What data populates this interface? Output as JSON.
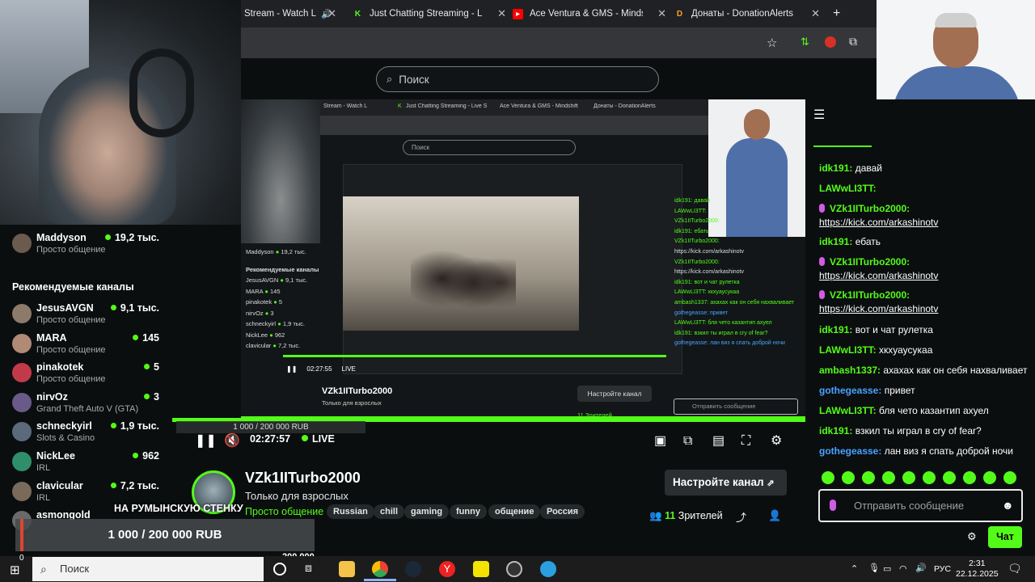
{
  "browser": {
    "tabs": [
      {
        "label": "Stream - Watch L",
        "icon": "speaker-icon"
      },
      {
        "label": "Just Chatting Streaming - Live S",
        "icon": "kick-logo-icon"
      },
      {
        "label": "Ace Ventura & GMS - Mindshift",
        "icon": "youtube-icon"
      },
      {
        "label": "Донаты - DonationAlerts",
        "icon": "donationalerts-icon"
      }
    ],
    "search_placeholder": "Поиск"
  },
  "nested": {
    "search": "Поиск",
    "left_title": "Рекомендуемые каналы",
    "top_channel": "Maddyson",
    "top_viewers": "19,2 тыс.",
    "channels": [
      "JesusAVGN",
      "MARA",
      "pinakotek",
      "nirvOz",
      "schneckyirl",
      "NickLee",
      "clavicular"
    ],
    "viewers": [
      "9,1 тыс.",
      "145",
      "5",
      "3",
      "1,9 тыс.",
      "962",
      "7,2 тыс."
    ],
    "channel_name": "VZk1IITurbo2000",
    "subtitle": "Только для взрослых",
    "setup_button": "Настройте канал",
    "time": "02:27:55",
    "live": "LIVE",
    "viewers_label": "11 Зрителей",
    "send_placeholder": "Отправить сообщение",
    "chat_lines": [
      "idk191: давай",
      "LAWwLI3TT:",
      "VZk1IITurbo2000:",
      "idk191: ебать",
      "VZk1IITurbo2000:",
      "https://kick.com/arkashinotv",
      "VZk1IITurbo2000:",
      "https://kick.com/arkashinotv",
      "idk191: вот и чат рулетка",
      "LAWwLI3TT: хкхуаусукаа",
      "ambash1337: ахахах как он себя нахваливает",
      "gothegeasse: привет",
      "LAWwLI3TT: бля чето казантип ахуел",
      "idk191: взкил ты играл в cry of fear?",
      "gothegeasse: лан виз я спать доброй ночи"
    ]
  },
  "sidebar": {
    "top": {
      "name": "Maddyson",
      "category": "Просто общение",
      "viewers": "19,2 тыс."
    },
    "section_title": "Рекомендуемые каналы",
    "channels": [
      {
        "name": "JesusAVGN",
        "category": "Просто общение",
        "viewers": "9,1 тыс."
      },
      {
        "name": "MARA",
        "category": "Просто общение",
        "viewers": "145"
      },
      {
        "name": "pinakotek",
        "category": "Просто общение",
        "viewers": "5"
      },
      {
        "name": "nirvOz",
        "category": "Grand Theft Auto V (GTA)",
        "viewers": "3"
      },
      {
        "name": "schneckyirl",
        "category": "Slots & Casino",
        "viewers": "1,9 тыс."
      },
      {
        "name": "NickLee",
        "category": "IRL",
        "viewers": "962"
      },
      {
        "name": "clavicular",
        "category": "IRL",
        "viewers": "7,2 тыс."
      },
      {
        "name": "asmongold",
        "category": "",
        "viewers": ""
      }
    ]
  },
  "player": {
    "time": "02:27:57",
    "live": "LIVE",
    "donation_small": "1 000 / 200 000 RUB",
    "progress": 1.0
  },
  "channel": {
    "name": "VZk1IITurbo2000",
    "title": "Только для взрослых",
    "category": "Просто общение",
    "tags": [
      "Russian",
      "chill",
      "gaming",
      "funny",
      "общение",
      "Россия"
    ],
    "setup_button": "Настройте канал",
    "viewers_count": "11",
    "viewers_label": "Зрителей"
  },
  "chat": {
    "lines": [
      {
        "user": "idk191",
        "text": "давай"
      },
      {
        "user": "LAWwLI3TT",
        "text": ""
      },
      {
        "user": "VZk1IITurbo2000",
        "text": ""
      },
      {
        "user": "",
        "text": "https://kick.com/arkashinotv"
      },
      {
        "user": "idk191",
        "text": "ебать"
      },
      {
        "user": "VZk1IITurbo2000",
        "text": ""
      },
      {
        "user": "",
        "text": "https://kick.com/arkashinotv"
      },
      {
        "user": "VZk1IITurbo2000",
        "text": ""
      },
      {
        "user": "",
        "text": "https://kick.com/arkashinotv"
      },
      {
        "user": "idk191",
        "text": "вот и чат рулетка"
      },
      {
        "user": "LAWwLI3TT",
        "text": "хкхуаусукаа"
      },
      {
        "user": "ambash1337",
        "text": "ахахах как он себя нахваливает"
      },
      {
        "user": "gothegeasse",
        "text": "привет"
      },
      {
        "user": "LAWwLI3TT",
        "text": "бля чето казантип ахуел"
      },
      {
        "user": "idk191",
        "text": "взкил ты играл в cry of fear?"
      },
      {
        "user": "gothegeasse",
        "text": "лан виз я спать доброй ночи"
      }
    ],
    "send_placeholder": "Отправить сообщение",
    "chat_button": "Чат"
  },
  "donation": {
    "title": "НА РУМЫНСКУЮ СТЕНКУ",
    "bar": "1 000 / 200 000 RUB",
    "total": "200 000"
  },
  "taskbar": {
    "search": "Поиск",
    "language": "РУС",
    "time": "2:31",
    "date": "22.12.2025",
    "badge": "0"
  },
  "colors": {
    "accent": "#53fc18",
    "background": "#0b0e0f",
    "chat_blue": "#4aa3ff"
  }
}
